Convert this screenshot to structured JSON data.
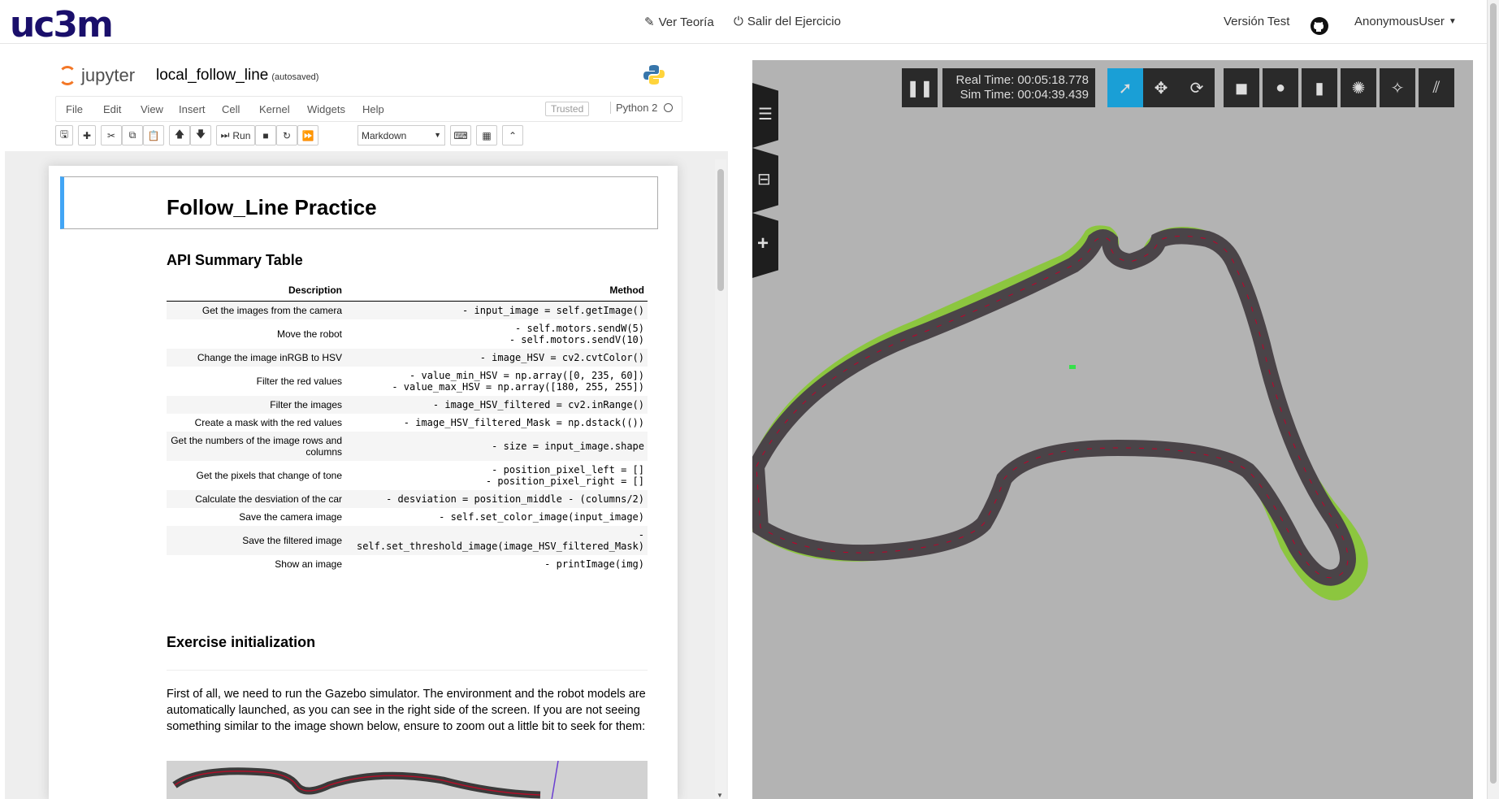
{
  "navbar": {
    "logo": "uc3m",
    "ver_teoria": "Ver Teoría",
    "salir": "Salir del Ejercicio",
    "version": "Versión Test",
    "user": "AnonymousUser"
  },
  "jupyter": {
    "brand": "jupyter",
    "notebook_name": "local_follow_line",
    "autosave": "(autosaved)",
    "menu": [
      "File",
      "Edit",
      "View",
      "Insert",
      "Cell",
      "Kernel",
      "Widgets",
      "Help"
    ],
    "trusted": "Trusted",
    "kernel": "Python 2",
    "run_label": "Run",
    "cell_type": "Markdown"
  },
  "notebook": {
    "title": "Follow_Line Practice",
    "api_heading": "API Summary Table",
    "col_description": "Description",
    "col_method": "Method",
    "rows": [
      {
        "d": "Get the images from the camera",
        "m": "- input_image = self.getImage()"
      },
      {
        "d": "Move the robot",
        "m": "- self.motors.sendW(5)\n- self.motors.sendV(10)"
      },
      {
        "d": "Change the image inRGB to HSV",
        "m": "- image_HSV = cv2.cvtColor()"
      },
      {
        "d": "Filter the red values",
        "m": "- value_min_HSV = np.array([0, 235, 60])\n- value_max_HSV = np.array([180, 255, 255])"
      },
      {
        "d": "Filter the images",
        "m": "- image_HSV_filtered = cv2.inRange()"
      },
      {
        "d": "Create a mask with the red values",
        "m": "- image_HSV_filtered_Mask = np.dstack(())"
      },
      {
        "d": "Get the numbers of the image rows and columns",
        "m": "- size = input_image.shape"
      },
      {
        "d": "Get the pixels that change of tone",
        "m": "- position_pixel_left = []\n- position_pixel_right = []"
      },
      {
        "d": "Calculate the desviation of the car",
        "m": "- desviation = position_middle - (columns/2)"
      },
      {
        "d": "Save the camera image",
        "m": "- self.set_color_image(input_image)"
      },
      {
        "d": "Save the filtered image",
        "m": "-\nself.set_threshold_image(image_HSV_filtered_Mask)"
      },
      {
        "d": "Show an image",
        "m": "- printImage(img)"
      }
    ],
    "init_heading": "Exercise initialization",
    "init_text": "First of all, we need to run the Gazebo simulator. The environment and the robot models are automatically launched, as you can see in the right side of the screen. If you are not seeing something similar to the image shown below, ensure to zoom out a little bit to seek for them:"
  },
  "gazebo": {
    "real_time": "Real Time: 00:05:18.778",
    "sim_time": "Sim Time: 00:04:39.439",
    "colors": {
      "grass": "#8cc63f",
      "road": "#4a4448",
      "ground": "#b3b3b3",
      "active": "#1a9fd6"
    }
  }
}
